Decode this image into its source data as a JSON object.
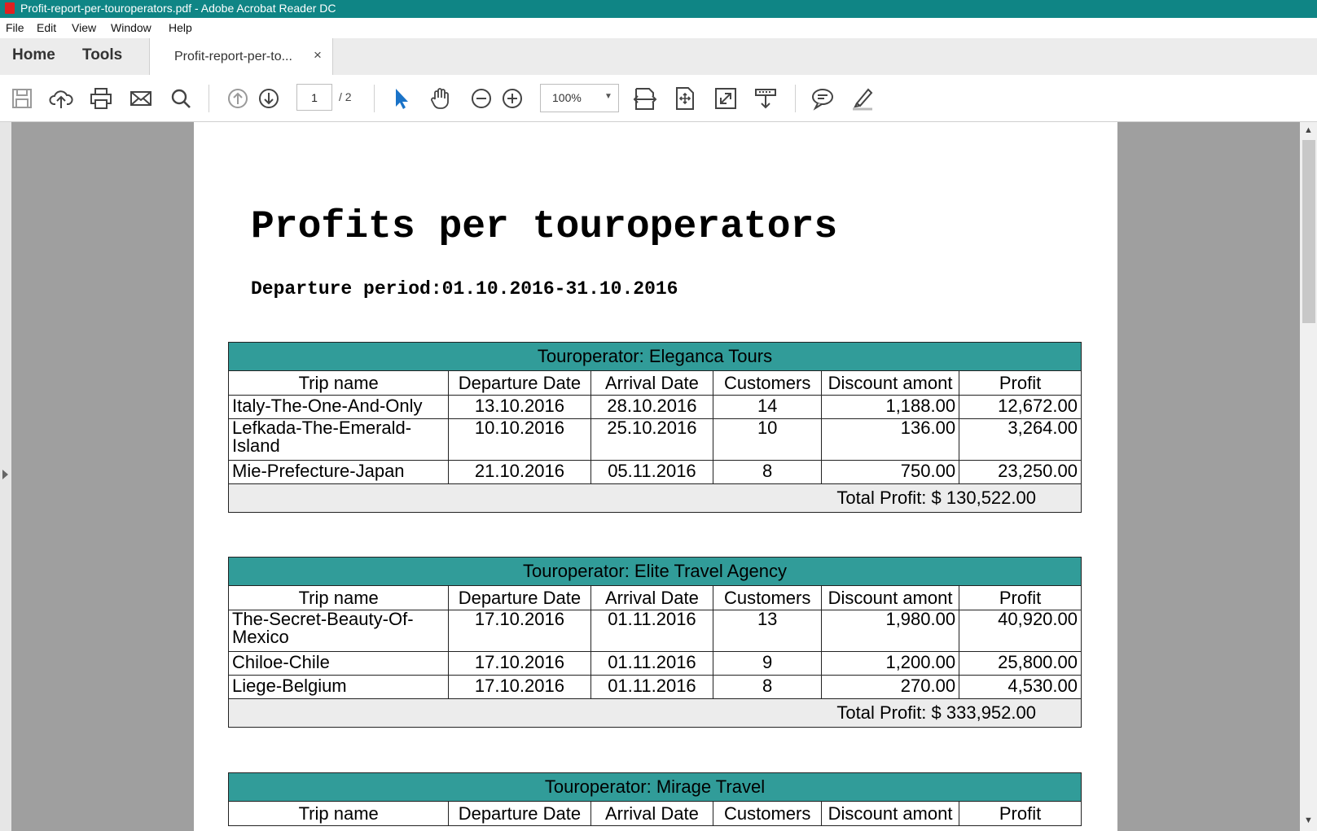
{
  "window": {
    "title": "Profit-report-per-touroperators.pdf - Adobe Acrobat Reader DC"
  },
  "menu": [
    "File",
    "Edit",
    "View",
    "Window",
    "Help"
  ],
  "tabs": {
    "home": "Home",
    "tools": "Tools",
    "document": "Profit-report-per-to...",
    "close": "×"
  },
  "toolbar": {
    "page_current": "1",
    "page_total": "/ 2",
    "zoom": "100%"
  },
  "document": {
    "title": "Profits per touroperators",
    "period": "Departure period:01.10.2016-31.10.2016",
    "columns": [
      "Trip name",
      "Departure Date",
      "Arrival Date",
      "Customers",
      "Discount amont",
      "Profit"
    ],
    "operators": [
      {
        "header": "Touroperator: Eleganca Tours",
        "rows": [
          [
            "Italy-The-One-And-Only",
            "13.10.2016",
            "28.10.2016",
            "14",
            "1,188.00",
            "12,672.00"
          ],
          [
            "Lefkada-The-Emerald-Island",
            "10.10.2016",
            "25.10.2016",
            "10",
            "136.00",
            "3,264.00"
          ],
          [
            "Mie-Prefecture-Japan",
            "21.10.2016",
            "05.11.2016",
            "8",
            "750.00",
            "23,250.00"
          ]
        ],
        "total": "Total Profit: $ 130,522.00"
      },
      {
        "header": "Touroperator: Elite Travel Agency",
        "rows": [
          [
            "The-Secret-Beauty-Of-Mexico",
            "17.10.2016",
            "01.11.2016",
            "13",
            "1,980.00",
            "40,920.00"
          ],
          [
            "Chiloe-Chile",
            "17.10.2016",
            "01.11.2016",
            "9",
            "1,200.00",
            "25,800.00"
          ],
          [
            "Liege-Belgium",
            "17.10.2016",
            "01.11.2016",
            "8",
            "270.00",
            "4,530.00"
          ]
        ],
        "total": "Total Profit: $ 333,952.00"
      },
      {
        "header": "Touroperator: Mirage Travel",
        "rows": [],
        "total": ""
      }
    ]
  }
}
